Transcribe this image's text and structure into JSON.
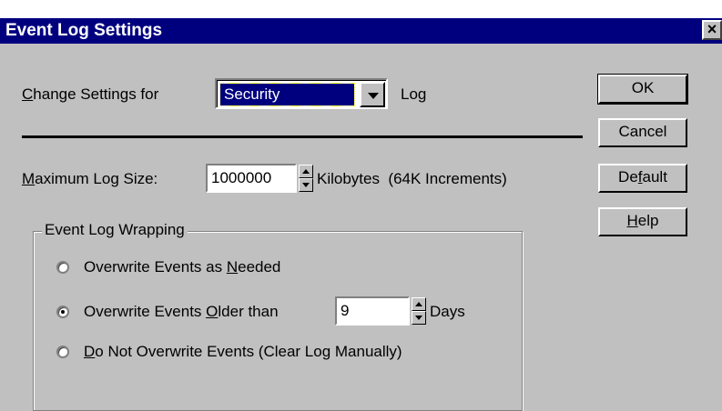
{
  "window": {
    "title": "Event Log Settings",
    "close_glyph": "×"
  },
  "log_selector": {
    "label_prefix": "C",
    "label_rest": "hange Settings for",
    "selected": "Security",
    "suffix": "Log"
  },
  "max_size": {
    "label_prefix": "M",
    "label_rest": "aximum Log Size:",
    "value": "1000000",
    "unit": "Kilobytes  (64K Increments)"
  },
  "wrapping": {
    "title": "Event Log Wrapping",
    "options": [
      {
        "pre": "Overwrite Events as ",
        "ul": "N",
        "post": "eeded",
        "selected": false
      },
      {
        "pre": "Overwrite Events ",
        "ul": "O",
        "post": "lder than",
        "selected": true
      },
      {
        "pre": "",
        "ul": "D",
        "post": "o Not Overwrite Events (Clear Log Manually)",
        "selected": false
      }
    ],
    "days_value": "9",
    "days_label": "Days"
  },
  "buttons": {
    "ok": "OK",
    "cancel": "Cancel",
    "default_pre": "De",
    "default_ul": "f",
    "default_post": "ault",
    "help_ul": "H",
    "help_post": "elp"
  }
}
